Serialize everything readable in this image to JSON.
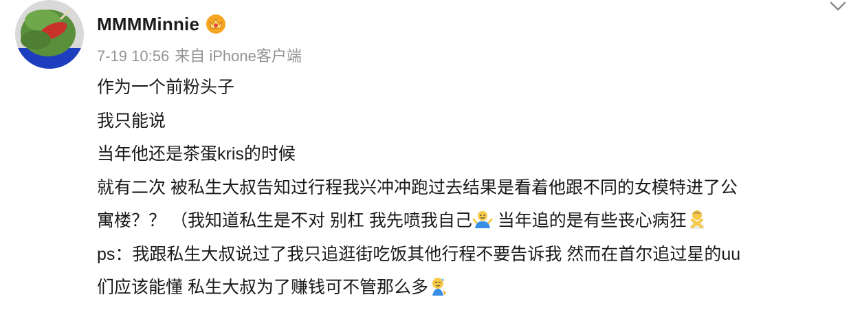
{
  "post": {
    "author": {
      "username": "MMMMinnie",
      "avatar_icon": "frog-avatar-icon",
      "badge_icon": "crown-badge-icon"
    },
    "meta": {
      "time": "7-19 10:56",
      "source": "来自 iPhone客户端"
    },
    "menu_icon": "chevron-down-icon",
    "body": {
      "line1": "作为一个前粉头子",
      "line2": "我只能说",
      "line3": "当年他还是茶蛋kris的时候",
      "line4": "就有二次 被私生大叔告知过行程我兴冲冲跑过去结果是看着他跟不同的女模特进了公",
      "line5a": "寓楼？？ （我知道私生是不对 别杠 我先喷我自己",
      "line5b": " 当年追的是有些丧心病狂",
      "line6": "ps：我跟私生大叔说过了我只追逛街吃饭其他行程不要告诉我 然而在首尔追过星的uu",
      "line7": "们应该能懂 私生大叔为了赚钱可不管那么多",
      "emoji_1": "shrug-emoji-icon",
      "emoji_2": "no-gesture-emoji-icon",
      "emoji_3": "sweat-smile-emoji-icon"
    }
  },
  "colors": {
    "text": "#1a1a1a",
    "meta": "#939393",
    "badge": "#f5a623"
  }
}
